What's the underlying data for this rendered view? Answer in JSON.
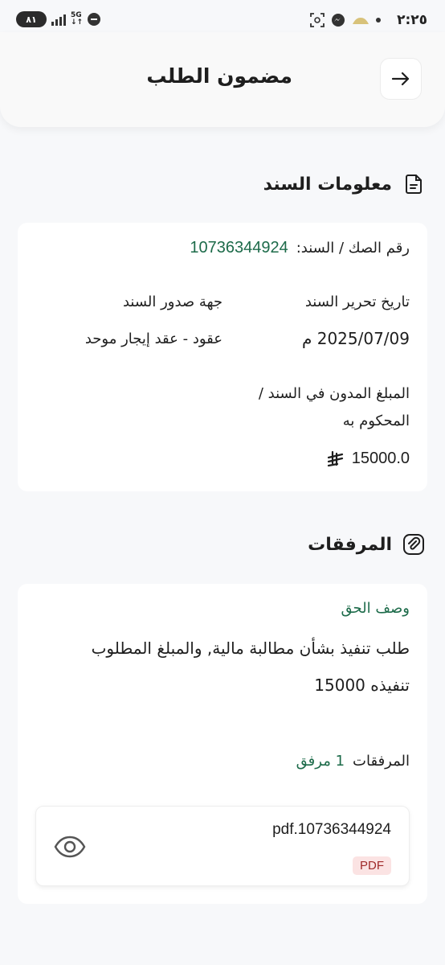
{
  "status_bar": {
    "time": "٢:٢٥",
    "battery": "٨١",
    "network": "5G"
  },
  "header": {
    "title": "مضمون الطلب"
  },
  "document_info": {
    "section_title": "معلومات السند",
    "deed_number_label": "رقم الصك / السند:",
    "deed_number_value": "10736344924",
    "issue_date_label": "تاريخ تحرير السند",
    "issue_date_value": "2025/07/09 م",
    "issuer_label": "جهة صدور السند",
    "issuer_value": "عقود - عقد إيجار موحد",
    "amount_label_line1": "المبلغ المدون في السند /",
    "amount_label_line2": "المحكوم به",
    "amount_value": "15000.0",
    "currency_symbol": "⃁"
  },
  "attachments": {
    "section_title": "المرفقات",
    "right_description_label": "وصف الحق",
    "right_description_line1": "طلب تنفيذ بشأن مطالبة مالية, والمبلغ المطلوب",
    "right_description_line2": "تنفيذه 15000",
    "attachments_label": "المرفقات",
    "attachments_count": "1 مرفق",
    "file": {
      "name": "pdf.10736344924",
      "badge": "PDF"
    }
  },
  "colors": {
    "accent_green": "#1d6b4a",
    "pdf_badge_bg": "#fbe3e3",
    "pdf_badge_text": "#a02a2a"
  },
  "icons": {
    "back": "arrow-right-icon",
    "document": "document-icon",
    "attachment": "paperclip-icon",
    "view": "eye-icon"
  }
}
